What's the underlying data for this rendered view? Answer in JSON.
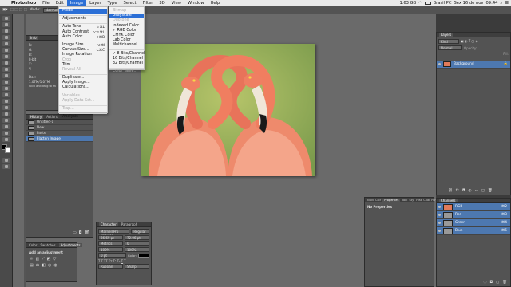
{
  "menubar": {
    "apple": "",
    "app": "Photoshop",
    "items": [
      "File",
      "Edit",
      "Image",
      "Layer",
      "Type",
      "Select",
      "Filter",
      "3D",
      "View",
      "Window",
      "Help"
    ],
    "selected": "Image",
    "status": [
      "1.63 GB",
      "Brasil PC",
      "Sex 16 de nov",
      "09:44"
    ]
  },
  "options_bar": {
    "mode_label": "Mode:",
    "mode_value": "Normal"
  },
  "image_menu": {
    "items": [
      {
        "label": "Mode",
        "shortcut": "",
        "state": "hi"
      },
      {
        "sep": true
      },
      {
        "label": "Adjustments",
        "shortcut": "",
        "state": ""
      },
      {
        "sep": true
      },
      {
        "label": "Auto Tone",
        "shortcut": "⇧⌘L",
        "state": ""
      },
      {
        "label": "Auto Contrast",
        "shortcut": "⌥⇧⌘L",
        "state": ""
      },
      {
        "label": "Auto Color",
        "shortcut": "⇧⌘B",
        "state": ""
      },
      {
        "sep": true
      },
      {
        "label": "Image Size...",
        "shortcut": "⌥⌘I",
        "state": ""
      },
      {
        "label": "Canvas Size...",
        "shortcut": "⌥⌘C",
        "state": ""
      },
      {
        "label": "Image Rotation",
        "shortcut": "",
        "state": ""
      },
      {
        "label": "Crop",
        "shortcut": "",
        "state": "dis"
      },
      {
        "label": "Trim...",
        "shortcut": "",
        "state": ""
      },
      {
        "label": "Reveal All",
        "shortcut": "",
        "state": "dis"
      },
      {
        "sep": true
      },
      {
        "label": "Duplicate...",
        "shortcut": "",
        "state": ""
      },
      {
        "label": "Apply Image...",
        "shortcut": "",
        "state": ""
      },
      {
        "label": "Calculations...",
        "shortcut": "",
        "state": ""
      },
      {
        "sep": true
      },
      {
        "label": "Variables",
        "shortcut": "",
        "state": "dis"
      },
      {
        "label": "Apply Data Set...",
        "shortcut": "",
        "state": "dis"
      },
      {
        "sep": true
      },
      {
        "label": "Trap...",
        "shortcut": "",
        "state": "dis"
      },
      {
        "sep": true
      },
      {
        "label": "Analysis",
        "shortcut": "",
        "state": ""
      }
    ]
  },
  "mode_submenu": {
    "items": [
      {
        "label": "Bitmap",
        "state": "dis"
      },
      {
        "label": "Grayscale",
        "state": "hi"
      },
      {
        "label": "Duotone",
        "state": "dis"
      },
      {
        "label": "Indexed Color...",
        "state": ""
      },
      {
        "label": "✓ RGB Color",
        "state": ""
      },
      {
        "label": "CMYK Color",
        "state": ""
      },
      {
        "label": "Lab Color",
        "state": ""
      },
      {
        "label": "Multichannel",
        "state": ""
      },
      {
        "sep": true
      },
      {
        "label": "✓ 8 Bits/Channel",
        "state": ""
      },
      {
        "label": "16 Bits/Channel",
        "state": ""
      },
      {
        "label": "32 Bits/Channel",
        "state": ""
      },
      {
        "sep": true
      },
      {
        "label": "Color Table...",
        "state": "dis"
      }
    ]
  },
  "info_panel": {
    "title": "Info",
    "lines": [
      "R:",
      "G:",
      "B:",
      "8-bit",
      "X:",
      "Y:",
      "Doc: 1.07M/1.07M",
      "Click and drag to move layer or selection. Use Shift and Opt for additional options."
    ]
  },
  "history_panel": {
    "tabs": [
      "History",
      "Actions"
    ],
    "rows": [
      "Untitled-1",
      "New",
      "Paste",
      "Flatten Image"
    ]
  },
  "adjustments_panel": {
    "tabs": [
      "Color",
      "Swatches",
      "Adjustments"
    ],
    "title": "Add an adjustment"
  },
  "character_panel": {
    "tabs": [
      "Character",
      "Paragraph"
    ],
    "font": "Marnell Pro Regular",
    "style": "Regular",
    "size": "36.69 pt",
    "leading": "72.06 pt",
    "kerning": "Metrics",
    "tracking": "0",
    "vscale": "100%",
    "hscale": "100%",
    "baseline": "0 pt",
    "color_label": "Color:",
    "language": "Russian",
    "aa": "Sharp"
  },
  "layers_panel": {
    "title": "Layers",
    "layer": "Background",
    "search": "Kind",
    "blend": "Normal",
    "opacity_label": "Opacity:",
    "fill_label": "Fill:"
  },
  "properties_panel": {
    "tabs": [
      "Navi",
      "Clor",
      "Properties",
      "Tool",
      "Styl",
      "Hist",
      "Chal",
      "Para"
    ],
    "active_tab": "Properties",
    "content": "No Properties"
  },
  "channels_panel": {
    "title": "Channels",
    "rows": [
      {
        "name": "RGB",
        "shortcut": "⌘2"
      },
      {
        "name": "Red",
        "shortcut": "⌘3"
      },
      {
        "name": "Green",
        "shortcut": "⌘4"
      },
      {
        "name": "Blue",
        "shortcut": "⌘5"
      }
    ]
  },
  "colors": {
    "accent": "#2b6fd6",
    "flamingo": "#e8755b",
    "background_green": "#9fb763"
  }
}
